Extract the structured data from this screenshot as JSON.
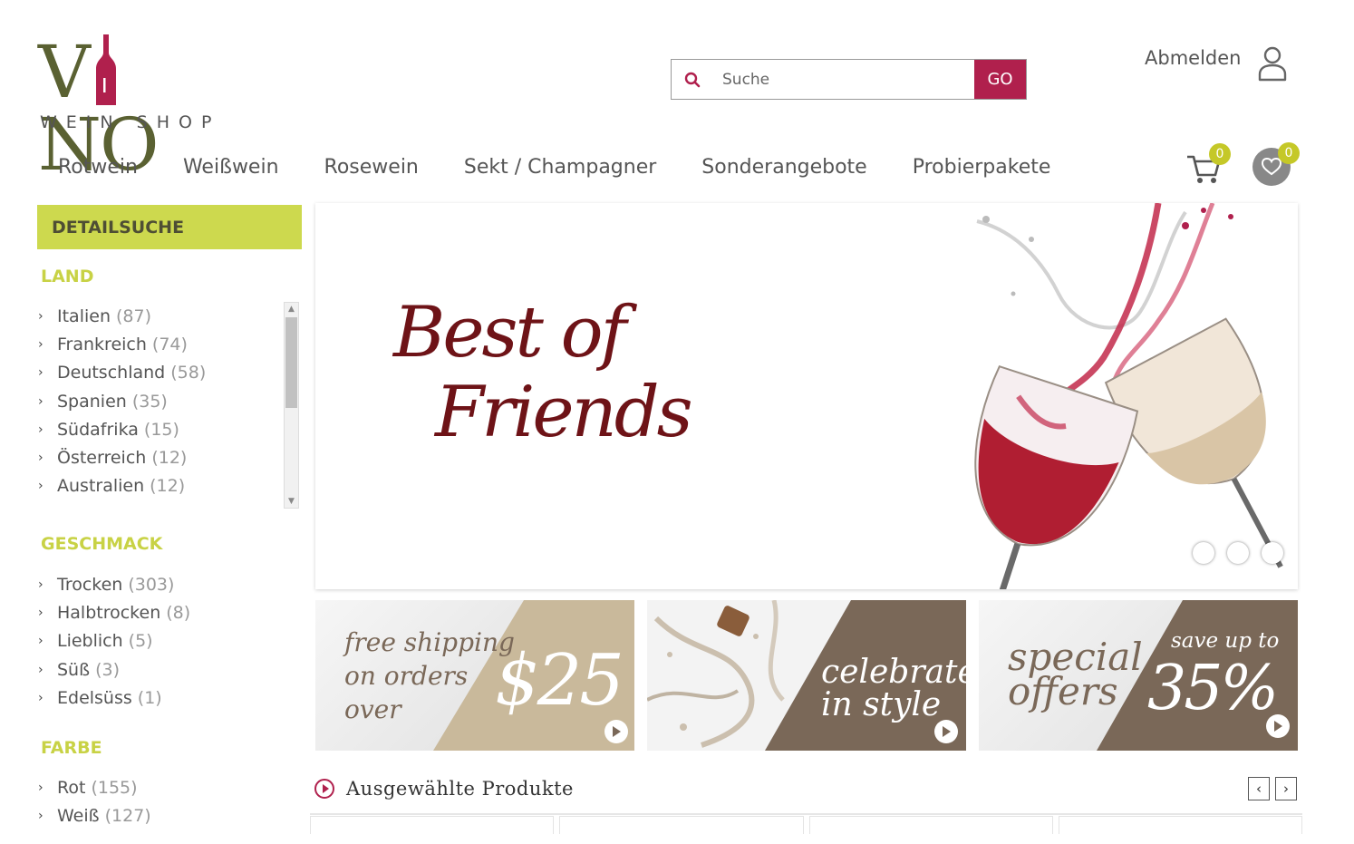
{
  "brand": {
    "name_left": "V",
    "name_right": "NO",
    "subtitle": "WEIN SHOP",
    "wine_color": "#b0204d",
    "olive_color": "#5a6132"
  },
  "search": {
    "placeholder": "Suche",
    "button": "GO"
  },
  "account": {
    "logout": "Abmelden"
  },
  "nav": [
    "Rotwein",
    "Weißwein",
    "Rosewein",
    "Sekt / Champagner",
    "Sonderangebote",
    "Probierpakete"
  ],
  "cart": {
    "count": "0"
  },
  "wishlist": {
    "count": "0"
  },
  "sidebar": {
    "header": "DETAILSUCHE",
    "groups": [
      {
        "title": "LAND",
        "items": [
          {
            "label": "Italien",
            "count": "(87)"
          },
          {
            "label": "Frankreich",
            "count": "(74)"
          },
          {
            "label": "Deutschland",
            "count": "(58)"
          },
          {
            "label": "Spanien",
            "count": "(35)"
          },
          {
            "label": "Südafrika",
            "count": "(15)"
          },
          {
            "label": "Österreich",
            "count": "(12)"
          },
          {
            "label": "Australien",
            "count": "(12)"
          }
        ]
      },
      {
        "title": "GESCHMACK",
        "items": [
          {
            "label": "Trocken",
            "count": "(303)"
          },
          {
            "label": "Halbtrocken",
            "count": "(8)"
          },
          {
            "label": "Lieblich",
            "count": "(5)"
          },
          {
            "label": "Süß",
            "count": "(3)"
          },
          {
            "label": "Edelsüss",
            "count": "(1)"
          }
        ]
      },
      {
        "title": "FARBE",
        "items": [
          {
            "label": "Rot",
            "count": "(155)"
          },
          {
            "label": "Weiß",
            "count": "(127)"
          }
        ]
      }
    ]
  },
  "hero": {
    "line1": "Best of",
    "line2": "Friends",
    "slides": 3
  },
  "promos": [
    {
      "left_text": [
        "free shipping",
        "on orders",
        "over"
      ],
      "right_text": "$25"
    },
    {
      "right_text": [
        "celebrate",
        "in style"
      ]
    },
    {
      "left_text": [
        "special",
        "offers"
      ],
      "right_text_small": "save up to",
      "right_text": "35%"
    }
  ],
  "featured": {
    "title": "Ausgewählte Produkte"
  },
  "colors": {
    "accent_lime": "#cdd94e",
    "promo_beige": "#c9b99b",
    "promo_brown": "#7a6858",
    "hero_text": "#6e1317"
  }
}
